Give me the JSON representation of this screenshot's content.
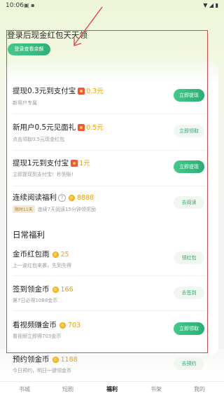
{
  "status": {
    "time": "10:06",
    "right_icons": "▼ ◢ ▮",
    "left_icons": "▣ ▪"
  },
  "header": {
    "title": "登录后现金红包天天领",
    "login_button": "登录查看余额"
  },
  "rows": [
    {
      "title": "提现0.3元到支付宝",
      "amount": "0.3元",
      "sub": "新用户专属",
      "button": "立即提现",
      "style": "filled"
    },
    {
      "title": "新用户0.5元见面礼",
      "amount": "0.5元",
      "sub": "点击领取0.5元现金红包",
      "button": "立即领取",
      "style": "outline"
    },
    {
      "title": "提现1元到支付宝",
      "amount": "1元",
      "sub": "立即提现到支付宝！秒到账!",
      "button": "立即提现",
      "style": "filled"
    },
    {
      "title": "连续阅读福利",
      "amount": "8888",
      "badge": "限时11天",
      "sub": "连续7天阅读15分钟领奖励",
      "button": "去阅读",
      "style": "outline"
    }
  ],
  "daily": {
    "section_title": "日常福利",
    "rows": [
      {
        "title": "金币红包雨",
        "amount": "25",
        "sub": "上一波红包来袭，先到先得",
        "button": "领红包",
        "style": "outline"
      },
      {
        "title": "签到领金币",
        "amount": "166",
        "sub": "第7日必得1088金币",
        "button": "去签到",
        "style": "outline"
      },
      {
        "title": "看视频赚金币",
        "amount": "703",
        "sub": "看视频立即得703金币",
        "button": "立即领取",
        "style": "filled"
      },
      {
        "title": "预约领金币",
        "amount": "1188",
        "sub": "今日预约，明日一键领金币",
        "button": "去预约",
        "style": "outline"
      }
    ]
  },
  "tabs": [
    {
      "label": "书城",
      "active": false
    },
    {
      "label": "短剧",
      "active": false
    },
    {
      "label": "福利",
      "active": true
    },
    {
      "label": "书架",
      "active": false
    },
    {
      "label": "我的",
      "active": false
    }
  ],
  "colors": {
    "accent_green": "#2aaf76",
    "annotation_red": "#e0454b",
    "coin_gold": "#f0a000"
  }
}
